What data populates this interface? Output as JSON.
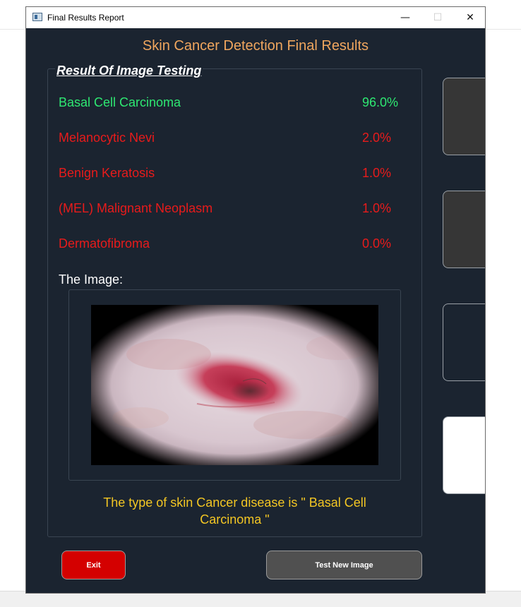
{
  "window": {
    "title": "Final Results Report",
    "controls": {
      "minimize": "—",
      "maximize": "☐",
      "close": "✕"
    }
  },
  "heading": "Skin Cancer Detection Final Results",
  "group_title": "Result Of Image Testing",
  "results": [
    {
      "name": "Basal Cell Carcinoma",
      "percent": "96.0%",
      "color": "#2ee872"
    },
    {
      "name": "Melanocytic Nevi",
      "percent": "2.0%",
      "color": "#e81b1b"
    },
    {
      "name": "Benign Keratosis",
      "percent": "1.0%",
      "color": "#e81b1b"
    },
    {
      "name": "(MEL) Malignant Neoplasm",
      "percent": "1.0%",
      "color": "#e81b1b"
    },
    {
      "name": "Dermatofibroma",
      "percent": "0.0%",
      "color": "#e81b1b"
    }
  ],
  "image_label": "The Image:",
  "conclusion": {
    "line1": "The type of skin Cancer disease is \" Basal Cell",
    "line2": "Carcinoma \""
  },
  "buttons": {
    "exit": "Exit",
    "test_new": "Test New Image"
  },
  "colors": {
    "background": "#1b2430",
    "heading": "#f0a65e",
    "conclusion": "#f3c623",
    "exit_button": "#d40000",
    "test_button": "#505050"
  }
}
